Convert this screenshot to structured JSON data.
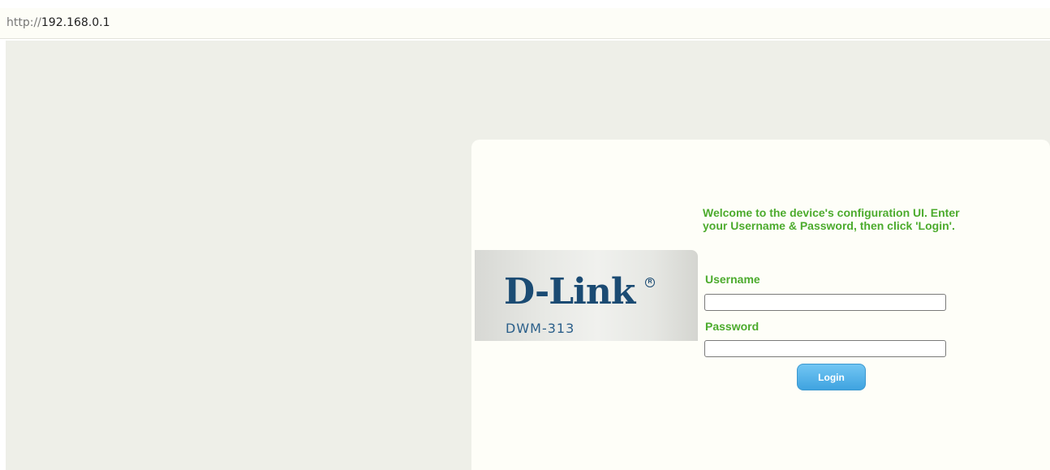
{
  "browser": {
    "url_scheme": "http://",
    "url_host": "192.168.0.1"
  },
  "login": {
    "brand": "D-Link",
    "registered_mark": "R",
    "model": "DWM-313",
    "welcome_text": "Welcome to the device's configuration UI. Enter your Username & Password, then click 'Login'.",
    "username_label": "Username",
    "username_value": "",
    "password_label": "Password",
    "password_value": "",
    "login_button": "Login"
  },
  "colors": {
    "accent_green": "#4cab2d",
    "brand_blue": "#1b4b73",
    "button_blue": "#3fa3e0",
    "background": "#eeefe8",
    "panel": "#fefef8"
  }
}
